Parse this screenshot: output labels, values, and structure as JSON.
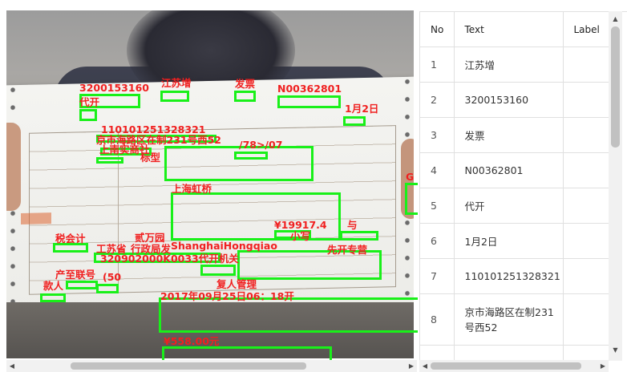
{
  "overlay": {
    "color": "#19f019",
    "label_color": "#f02020",
    "labels": [
      "3200153160",
      "江苏增",
      "发票",
      "N00362801",
      "代开",
      "1月2日",
      "110101251328321",
      "京市海路区在制231号西52",
      "上南实商社",
      "/78>/07",
      "标型",
      "上海虹桥",
      "¥19917.4",
      "与",
      "小写",
      "税会计",
      "贰万园",
      "ShanghaiHongqiao",
      "工苏省",
      "行政局发",
      "320902000K0033代开机关",
      "先开专营",
      "产至联号",
      "(50",
      "款人",
      "复人管理",
      "2017年09月25日06：18开",
      "¥558.00元",
      "G"
    ]
  },
  "table": {
    "headers": [
      "No",
      "Text",
      "Label"
    ],
    "rows": [
      {
        "no": "1",
        "text": "江苏增",
        "label": ""
      },
      {
        "no": "2",
        "text": "3200153160",
        "label": ""
      },
      {
        "no": "3",
        "text": "发票",
        "label": ""
      },
      {
        "no": "4",
        "text": "N00362801",
        "label": ""
      },
      {
        "no": "5",
        "text": "代开",
        "label": ""
      },
      {
        "no": "6",
        "text": "1月2日",
        "label": ""
      },
      {
        "no": "7",
        "text": "110101251328321",
        "label": ""
      },
      {
        "no": "8",
        "text": "京市海路区在制231号西52",
        "label": ""
      }
    ]
  },
  "scrollbar_arrows": {
    "left": "◀",
    "right": "▶",
    "up": "▲",
    "down": "▼"
  }
}
